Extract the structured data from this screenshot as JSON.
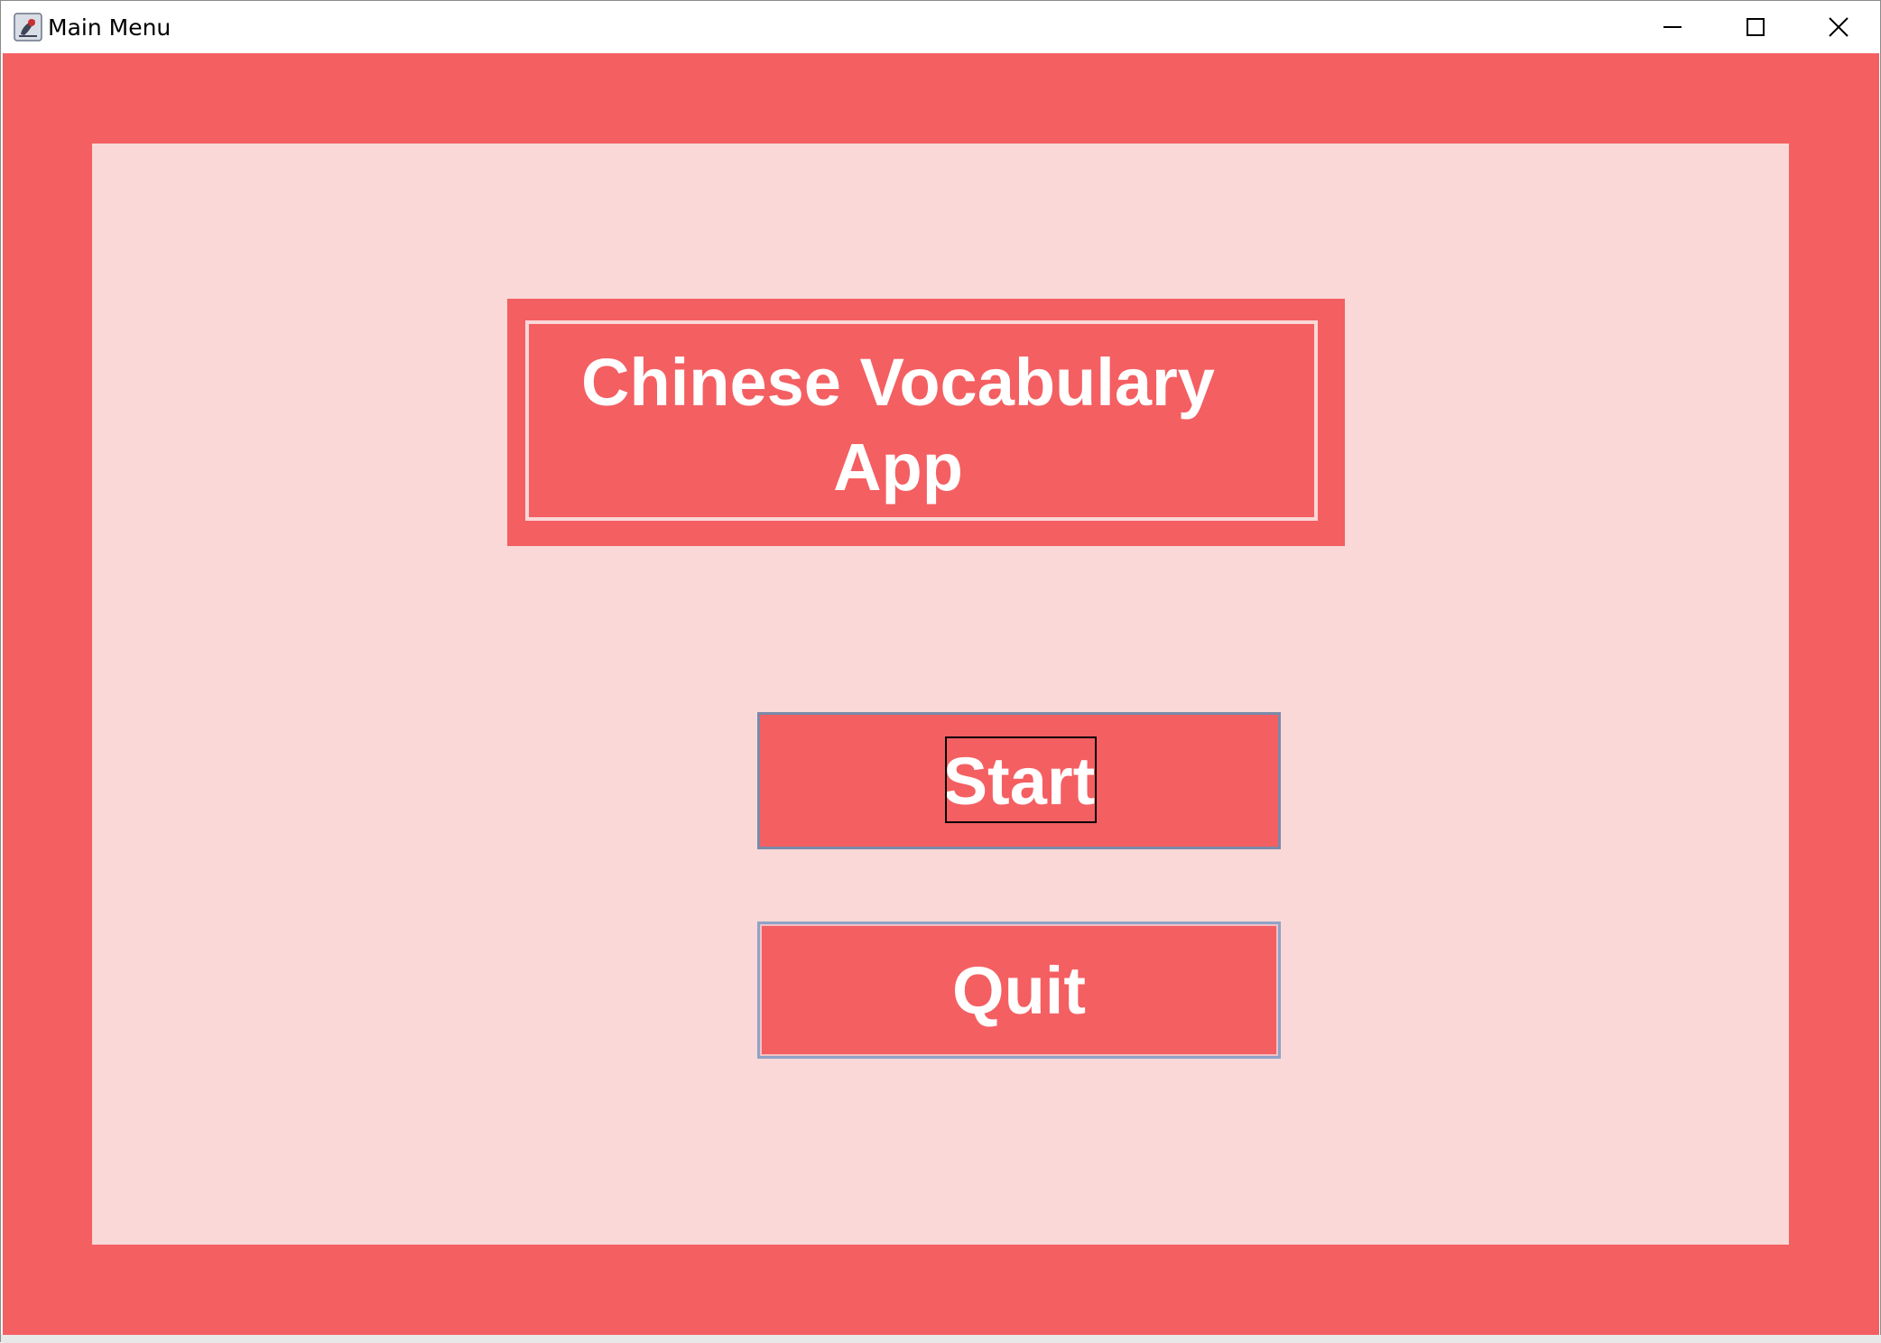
{
  "window": {
    "title": "Main Menu",
    "icon": "java-app-icon",
    "controls": {
      "minimize": "minimize-icon",
      "maximize": "maximize-icon",
      "close": "close-icon"
    }
  },
  "colors": {
    "accent": "#f45f62",
    "panel": "#f9d8d7",
    "text": "#ffffff"
  },
  "main": {
    "heading_line1": "Chinese Vocabulary",
    "heading_line2": "App",
    "start_label": "Start",
    "quit_label": "Quit"
  }
}
